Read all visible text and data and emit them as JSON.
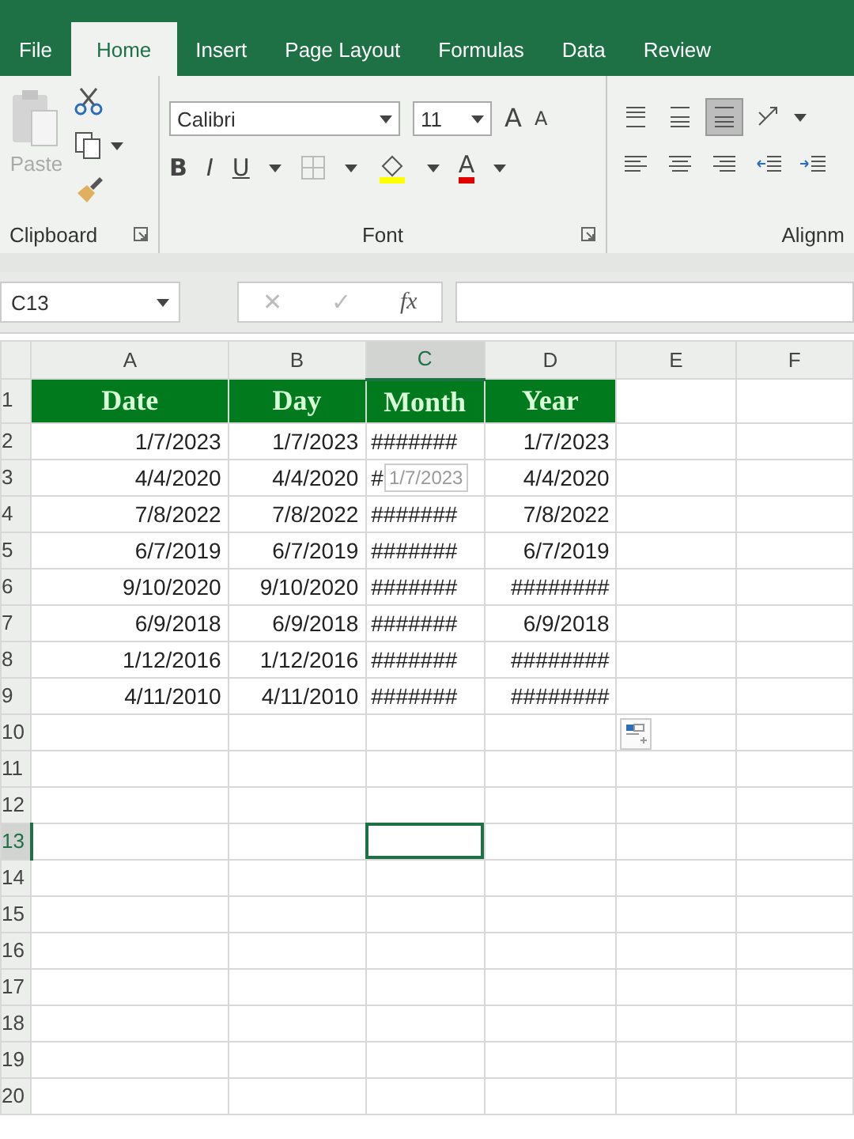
{
  "tabs": [
    {
      "label": "File",
      "selected": false
    },
    {
      "label": "Home",
      "selected": true
    },
    {
      "label": "Insert",
      "selected": false
    },
    {
      "label": "Page Layout",
      "selected": false
    },
    {
      "label": "Formulas",
      "selected": false
    },
    {
      "label": "Data",
      "selected": false
    },
    {
      "label": "Review",
      "selected": false
    }
  ],
  "ribbon": {
    "clipboard": {
      "label": "Clipboard",
      "paste": "Paste",
      "paste_disabled": true
    },
    "font": {
      "label": "Font",
      "font_name": "Calibri",
      "font_size": "11",
      "grow": "A",
      "shrink": "A",
      "bold": "B",
      "italic": "I",
      "underline": "U",
      "font_color": "A"
    },
    "alignment": {
      "label": "Alignm",
      "buttons": [
        {
          "kind": "top",
          "selected": false
        },
        {
          "kind": "middle",
          "selected": false
        },
        {
          "kind": "bottom",
          "selected": true
        },
        {
          "kind": "orientation",
          "selected": false
        },
        {
          "kind": "left",
          "selected": false
        },
        {
          "kind": "center",
          "selected": false
        },
        {
          "kind": "right",
          "selected": false
        },
        {
          "kind": "outdent",
          "selected": false
        },
        {
          "kind": "indent",
          "selected": false
        }
      ]
    }
  },
  "formula_bar": {
    "name_box": "C13",
    "cancel": "✕",
    "enter": "✓",
    "fx": "fx"
  },
  "sheet": {
    "columns": [
      {
        "label": "A",
        "selected": false
      },
      {
        "label": "B",
        "selected": false
      },
      {
        "label": "C",
        "selected": true
      },
      {
        "label": "D",
        "selected": false
      },
      {
        "label": "E",
        "selected": false
      },
      {
        "label": "F",
        "selected": false
      }
    ],
    "rows": [
      {
        "number": "1",
        "selected": false,
        "kind": "header",
        "cells": [
          "Date",
          "Day",
          "Month",
          "Year"
        ]
      },
      {
        "number": "2",
        "selected": false,
        "kind": "data",
        "cells": [
          "1/7/2023",
          "1/7/2023",
          "#######",
          "1/7/2023"
        ]
      },
      {
        "number": "3",
        "selected": false,
        "kind": "data",
        "cells": [
          "4/4/2020",
          "4/4/2020",
          "#",
          "4/4/2020"
        ]
      },
      {
        "number": "4",
        "selected": false,
        "kind": "data",
        "cells": [
          "7/8/2022",
          "7/8/2022",
          "#######",
          "7/8/2022"
        ]
      },
      {
        "number": "5",
        "selected": false,
        "kind": "data",
        "cells": [
          "6/7/2019",
          "6/7/2019",
          "#######",
          "6/7/2019"
        ]
      },
      {
        "number": "6",
        "selected": false,
        "kind": "data",
        "cells": [
          "9/10/2020",
          "9/10/2020",
          "#######",
          "########"
        ]
      },
      {
        "number": "7",
        "selected": false,
        "kind": "data",
        "cells": [
          "6/9/2018",
          "6/9/2018",
          "#######",
          "6/9/2018"
        ]
      },
      {
        "number": "8",
        "selected": false,
        "kind": "data",
        "cells": [
          "1/12/2016",
          "1/12/2016",
          "#######",
          "########"
        ]
      },
      {
        "number": "9",
        "selected": false,
        "kind": "data",
        "cells": [
          "4/11/2010",
          "4/11/2010",
          "#######",
          "########"
        ]
      },
      {
        "number": "10",
        "selected": false,
        "kind": "empty",
        "cells": []
      },
      {
        "number": "11",
        "selected": false,
        "kind": "empty",
        "cells": []
      },
      {
        "number": "12",
        "selected": false,
        "kind": "empty",
        "cells": []
      },
      {
        "number": "13",
        "selected": true,
        "kind": "empty",
        "cells": []
      },
      {
        "number": "14",
        "selected": false,
        "kind": "empty",
        "cells": []
      },
      {
        "number": "15",
        "selected": false,
        "kind": "empty",
        "cells": []
      },
      {
        "number": "16",
        "selected": false,
        "kind": "empty",
        "cells": []
      },
      {
        "number": "17",
        "selected": false,
        "kind": "empty",
        "cells": []
      },
      {
        "number": "18",
        "selected": false,
        "kind": "empty",
        "cells": []
      },
      {
        "number": "19",
        "selected": false,
        "kind": "empty",
        "cells": []
      },
      {
        "number": "20",
        "selected": false,
        "kind": "empty",
        "cells": []
      }
    ],
    "tooltip": "1/7/2023"
  }
}
